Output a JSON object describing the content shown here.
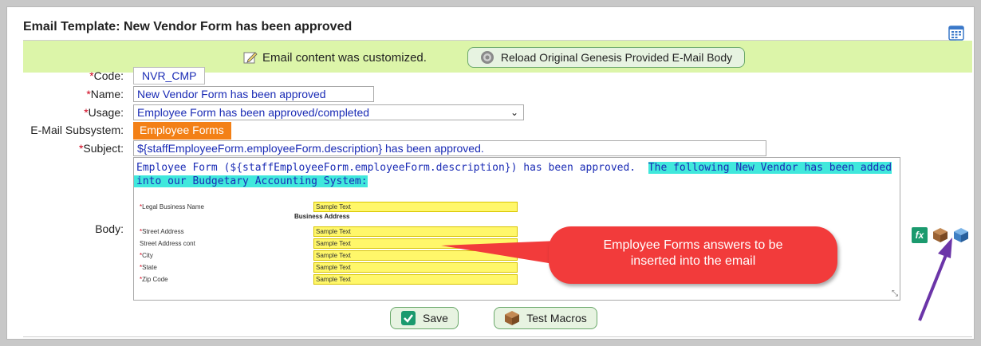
{
  "panel": {
    "title": "Email Template: New Vendor Form has been approved"
  },
  "notice": {
    "message": "Email content was customized.",
    "reload_label": "Reload Original Genesis Provided E-Mail Body"
  },
  "fields": {
    "code_label": "Code:",
    "code_value": "NVR_CMP",
    "name_label": "Name:",
    "name_value": "New Vendor Form has been approved",
    "usage_label": "Usage:",
    "usage_value": "Employee Form has been approved/completed",
    "subsystem_label": "E-Mail Subsystem:",
    "subsystem_value": "Employee Forms",
    "subject_label": "Subject:",
    "subject_value": "${staffEmployeeForm.employeeForm.description} has been approved.",
    "body_label": "Body:",
    "required_marker": "*"
  },
  "body": {
    "line1_plain": "Employee Form (${staffEmployeeForm.employeeForm.description}) has been approved.",
    "line1_highlight": "The following New Vendor has been added",
    "line2_highlight": "into our Budgetary Accounting System:",
    "form": {
      "section_header": "Business Address",
      "rows": [
        {
          "label": "Legal Business Name",
          "required": "*",
          "value": "Sample Text"
        },
        {
          "label": "Street Address",
          "required": "*",
          "value": "Sample Text"
        },
        {
          "label": "Street Address cont",
          "required": "",
          "value": "Sample Text"
        },
        {
          "label": "City",
          "required": "*",
          "value": "Sample Text"
        },
        {
          "label": "State",
          "required": "*",
          "value": "Sample Text"
        },
        {
          "label": "Zip Code",
          "required": "*",
          "value": "Sample Text"
        }
      ]
    }
  },
  "callout": {
    "line1": "Employee Forms answers to be",
    "line2": "inserted into the email"
  },
  "buttons": {
    "save_label": "Save",
    "test_label": "Test Macros"
  },
  "icons": {
    "fx": "fx",
    "accent_callout": "#f23b3b",
    "accent_notice": "#dcf5a9",
    "accent_subsystem": "#f38016",
    "accent_highlight": "#40e8dc",
    "arrow_color": "#6b35a8"
  }
}
